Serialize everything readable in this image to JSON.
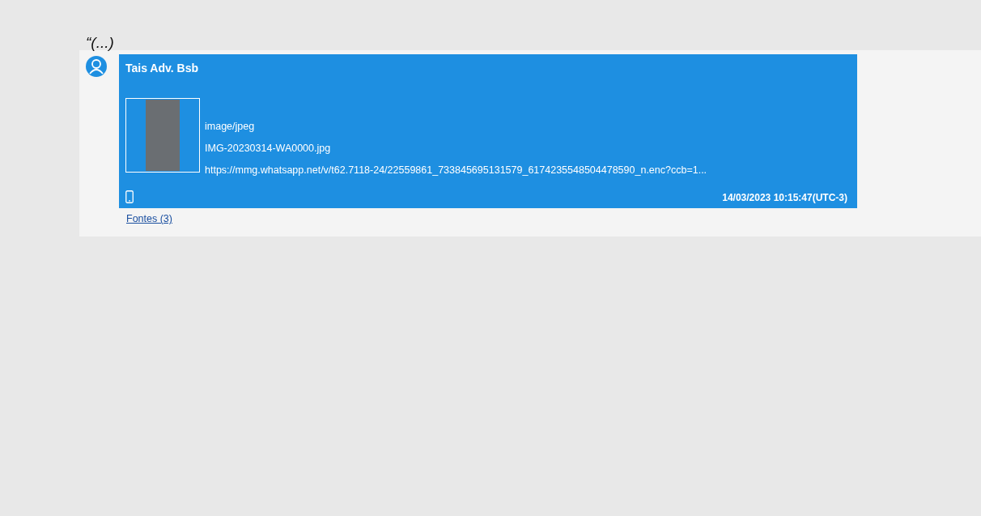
{
  "quote_mark": "“(...)",
  "message": {
    "sender": "Tais Adv. Bsb",
    "attachment": {
      "mime_type": "image/jpeg",
      "file_name": "IMG-20230314-WA0000.jpg",
      "url": "https://mmg.whatsapp.net/v/t62.7118-24/22559861_733845695131579_6174235548504478590_n.enc?ccb=1..."
    },
    "timestamp": "14/03/2023 10:15:47(UTC-3)"
  },
  "sources_link": "Fontes (3)"
}
